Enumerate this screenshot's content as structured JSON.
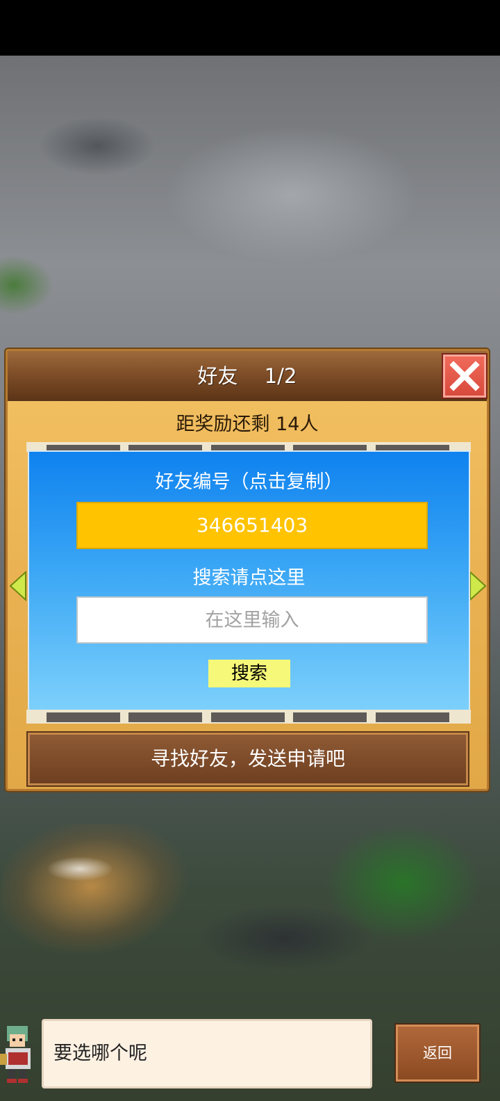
{
  "dialog": {
    "title": "好友　 1/2",
    "reward_text": "距奖励还剩 14人",
    "friend_id_label": "好友编号（点击复制）",
    "friend_id": "346651403",
    "search_label": "搜索请点这里",
    "search_placeholder": "在这里输入",
    "search_button": "搜索",
    "find_button": "寻找好友，发送申请吧"
  },
  "footer": {
    "message": "要选哪个呢",
    "back_button": "返回"
  },
  "icons": {
    "close": "close-icon",
    "left_arrow": "arrow-left-icon",
    "right_arrow": "arrow-right-icon"
  },
  "colors": {
    "panel": "#eab252",
    "header": "#7a4a25",
    "close": "#d84a3c",
    "blue_top": "#0f82ef",
    "blue_bottom": "#7dd0fb",
    "id_box": "#ffc300",
    "search_button": "#f5f878",
    "find_button": "#6e3f20"
  }
}
